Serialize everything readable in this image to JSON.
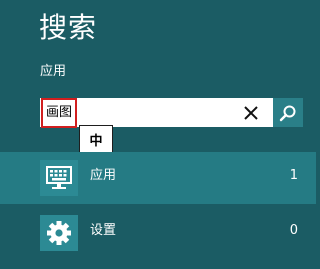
{
  "header": {
    "title": "搜索",
    "scope": "应用"
  },
  "search": {
    "query": "画图",
    "clear_icon": "close-icon",
    "submit_icon": "search-icon"
  },
  "ime": {
    "indicator": "中"
  },
  "results": [
    {
      "label": "应用",
      "count": "1",
      "icon": "keyboard-monitor-icon",
      "selected": true
    },
    {
      "label": "设置",
      "count": "0",
      "icon": "gear-icon",
      "selected": false
    }
  ],
  "colors": {
    "background": "#1b5c64",
    "selected_row": "#257b84",
    "icon_tile": "#2c8a94",
    "search_button": "#2a7f88",
    "highlight_border": "#d11f1f"
  }
}
